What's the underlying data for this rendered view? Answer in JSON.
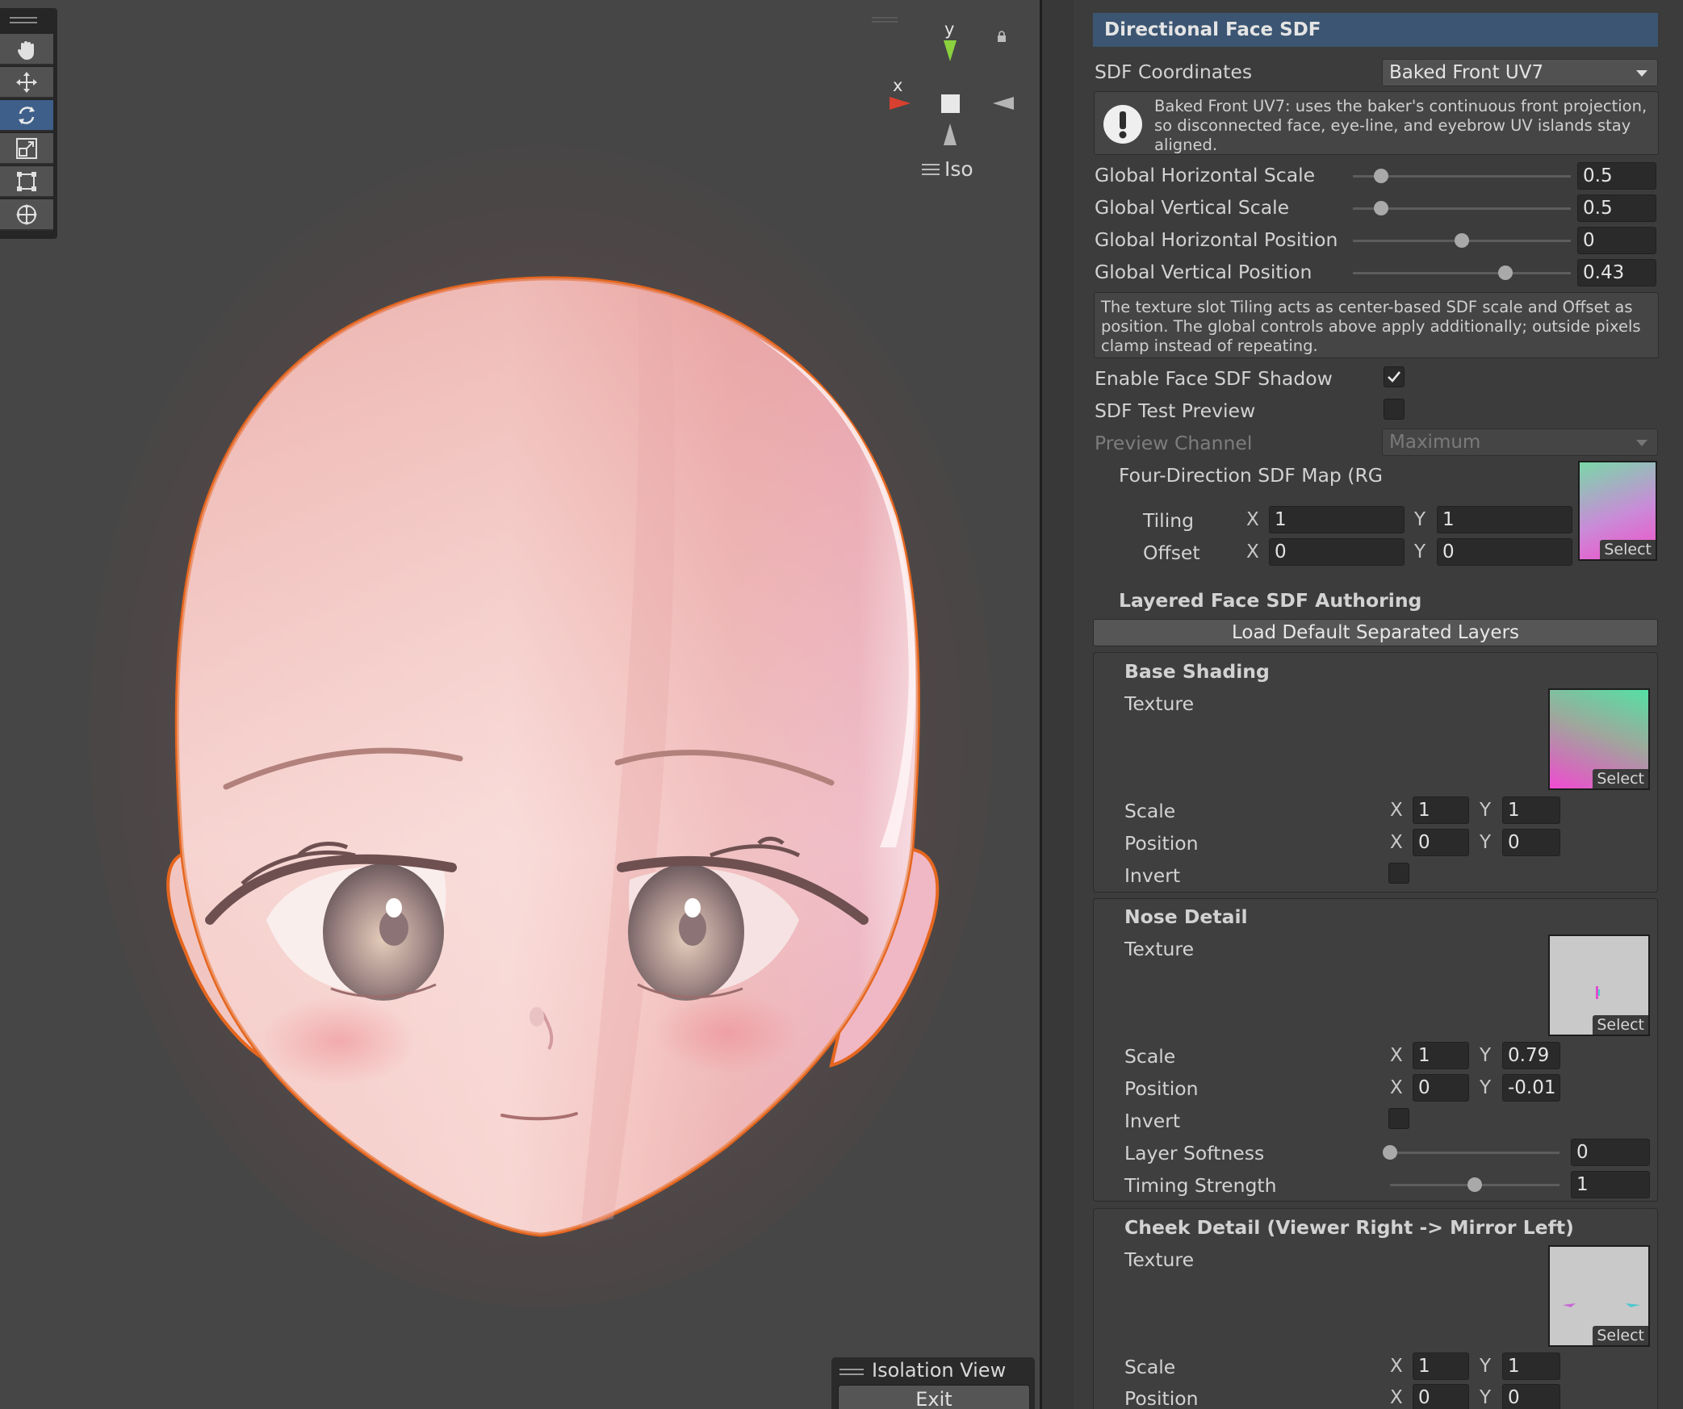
{
  "scene": {
    "gizmo": {
      "y_label": "y",
      "x_label": "x",
      "projection_label": "Iso"
    },
    "toolbar_tools": [
      "hand-tool",
      "move-tool",
      "rotate-tool",
      "scale-tool",
      "rect-tool",
      "transform-tool"
    ],
    "isolation": {
      "title": "Isolation View",
      "exit_label": "Exit"
    }
  },
  "inspector": {
    "section_title": "Directional Face SDF",
    "sdf_coordinates": {
      "label": "SDF Coordinates",
      "value": "Baked Front UV7"
    },
    "help_coords": "Baked Front UV7: uses the baker's continuous front projection, so disconnected face, eye-line, and eyebrow UV islands stay aligned.",
    "sliders": [
      {
        "label": "Global Horizontal Scale",
        "value": "0.5",
        "fraction": 0.13
      },
      {
        "label": "Global Vertical Scale",
        "value": "0.5",
        "fraction": 0.13
      },
      {
        "label": "Global Horizontal Position",
        "value": "0",
        "fraction": 0.5
      },
      {
        "label": "Global Vertical Position",
        "value": "0.43",
        "fraction": 0.7
      }
    ],
    "help_tiling": "The texture slot Tiling acts as center-based SDF scale and Offset as position. The global controls above apply additionally; outside pixels clamp instead of repeating.",
    "enable_shadow": {
      "label": "Enable Face SDF Shadow",
      "checked": true
    },
    "test_preview": {
      "label": "SDF Test Preview",
      "checked": false
    },
    "preview_channel": {
      "label": "Preview Channel",
      "value": "Maximum"
    },
    "sdf_map": {
      "label": "Four-Direction SDF Map (RG",
      "tiling_label": "Tiling",
      "offset_label": "Offset",
      "tiling_x": "1",
      "tiling_y": "1",
      "offset_x": "0",
      "offset_y": "0",
      "select_label": "Select"
    },
    "axis_x": "X",
    "axis_y": "Y",
    "layered_title": "Layered Face SDF Authoring",
    "load_button": "Load Default Separated Layers",
    "layers": {
      "base": {
        "title": "Base Shading",
        "texture_label": "Texture",
        "select_label": "Select",
        "scale_label": "Scale",
        "scale_x": "1",
        "scale_y": "1",
        "position_label": "Position",
        "position_x": "0",
        "position_y": "0",
        "invert_label": "Invert",
        "invert": false
      },
      "nose": {
        "title": "Nose Detail",
        "texture_label": "Texture",
        "select_label": "Select",
        "scale_label": "Scale",
        "scale_x": "1",
        "scale_y": "0.79",
        "position_label": "Position",
        "position_x": "0",
        "position_y": "-0.01",
        "invert_label": "Invert",
        "invert": false,
        "softness": {
          "label": "Layer Softness",
          "value": "0",
          "fraction": 0.0
        },
        "timing": {
          "label": "Timing Strength",
          "value": "1",
          "fraction": 0.5
        }
      },
      "cheek": {
        "title": "Cheek Detail (Viewer Right -> Mirror Left)",
        "texture_label": "Texture",
        "select_label": "Select",
        "scale_label": "Scale",
        "scale_x": "1",
        "scale_y": "1",
        "position_label": "Position",
        "position_x": "0",
        "position_y": "0"
      }
    }
  }
}
